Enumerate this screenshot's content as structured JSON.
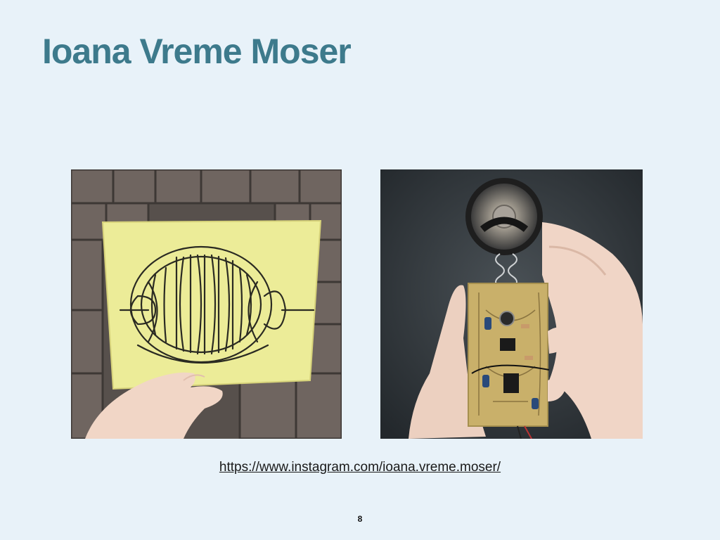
{
  "slide": {
    "title": "Ioana Vreme Moser",
    "link_text": "https://www.instagram.com/ioana.vreme.moser/",
    "page_number": "8"
  },
  "images": {
    "left": {
      "subject": "hand holding yellow board with etched circuit trace pattern over brick pavement"
    },
    "right": {
      "subject": "hands holding assembled circuit board with speaker on wire springs"
    }
  },
  "colors": {
    "background": "#e8f2f9",
    "title": "#3d7a8c",
    "board": "#ecec98",
    "pcb": "#c9b06a"
  }
}
